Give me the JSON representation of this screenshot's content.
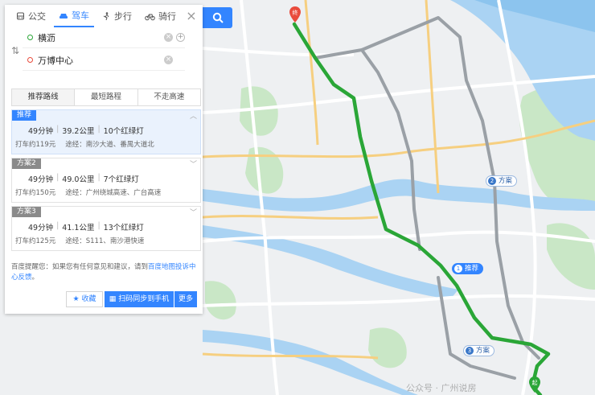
{
  "modes": [
    {
      "label": "公交",
      "icon": "bus-icon"
    },
    {
      "label": "驾车",
      "icon": "car-icon"
    },
    {
      "label": "步行",
      "icon": "walk-icon"
    },
    {
      "label": "骑行",
      "icon": "bike-icon"
    }
  ],
  "active_mode": "驾车",
  "origin": "横沥",
  "destination": "万博中心",
  "preferences": [
    "推荐路线",
    "最短路程",
    "不走高速"
  ],
  "routes": [
    {
      "tag": "推荐",
      "time": "49分钟",
      "distance": "39.2公里",
      "lights": "10个红绿灯",
      "taxi": "打车约119元",
      "via": "途经：南沙大道、番禺大道北"
    },
    {
      "tag": "方案2",
      "time": "49分钟",
      "distance": "49.0公里",
      "lights": "7个红绿灯",
      "taxi": "打车约150元",
      "via": "途经：广州绕城高速、广台高速"
    },
    {
      "tag": "方案3",
      "time": "49分钟",
      "distance": "41.1公里",
      "lights": "13个红绿灯",
      "taxi": "打车约125元",
      "via": "途经：S111、南沙港快速"
    }
  ],
  "feedback": {
    "prefix": "百度提醒您：如果您有任何意见和建议，请到",
    "link": "百度地图投诉中心反馈",
    "suffix": "。"
  },
  "buttons": {
    "favorite": "收藏",
    "qr": "扫码同步到手机",
    "more": "更多"
  },
  "map_labels": [
    {
      "num": "1",
      "text": "推荐"
    },
    {
      "num": "2",
      "text": "方案"
    },
    {
      "num": "3",
      "text": "方案"
    }
  ],
  "pins": {
    "start": "终",
    "end": "起"
  },
  "watermark": "公众号 · 广州说房",
  "colors": {
    "accent": "#3385ff",
    "route_main": "#2aa637",
    "route_alt": "#9aa0a6",
    "water": "#a9d3f2",
    "green": "#c8e6c4"
  }
}
